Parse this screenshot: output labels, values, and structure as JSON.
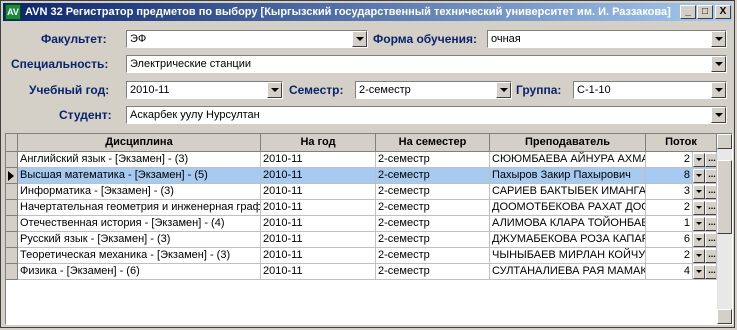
{
  "window": {
    "title": "AVN 32 Регистратор предметов по выбору [Кыргызский государственный технический университет им. И. Раззакова]",
    "icon_label": "AV",
    "buttons": [
      "_",
      "□",
      "X"
    ]
  },
  "form": {
    "faculty_label": "Факультет:",
    "faculty_value": "ЭФ",
    "study_form_label": "Форма обучения:",
    "study_form_value": "очная",
    "specialty_label": "Специальность:",
    "specialty_value": "Электрические станции",
    "year_label": "Учебный год:",
    "year_value": "2010-11",
    "semester_label": "Семестр:",
    "semester_value": "2-семестр",
    "group_label": "Группа:",
    "group_value": "С-1-10",
    "student_label": "Студент:",
    "student_value": "Аскарбек уулу Нурсултан"
  },
  "table": {
    "headers": [
      "Дисциплина",
      "На год",
      "На семестер",
      "Преподаватель",
      "Поток"
    ],
    "rows": [
      {
        "discipline": "Английский язык - [Экзамен] - (3)",
        "year": "2010-11",
        "semester": "2-семестр",
        "teacher": "СЮЮМБАЕВА АЙНУРА АХМАТБЕ",
        "potok": "2"
      },
      {
        "discipline": "Высшая математика - [Экзамен] - (5)",
        "year": "2010-11",
        "semester": "2-семестр",
        "teacher": "Пахыров Закир Пахырович",
        "potok": "8"
      },
      {
        "discipline": "Информатика - [Экзамен] - (3)",
        "year": "2010-11",
        "semester": "2-семестр",
        "teacher": "САРИЕВ БАКТЫБЕК ИМАНГАЗИ",
        "potok": "3"
      },
      {
        "discipline": "Начертательная геометрия и инженерная графика",
        "year": "2010-11",
        "semester": "2-семестр",
        "teacher": "ДООМОТБЕКОВА РАХАТ ДООМ",
        "potok": "2"
      },
      {
        "discipline": "Отечественная история - [Экзамен] - (4)",
        "year": "2010-11",
        "semester": "2-семестр",
        "teacher": "АЛИМОВА КЛАРА ТОЙОНБАЕВА",
        "potok": "1"
      },
      {
        "discipline": "Русский язык - [Экзамен] - (3)",
        "year": "2010-11",
        "semester": "2-семестр",
        "teacher": "ДЖУМАБЕКОВА РОЗА КАПАРО",
        "potok": "6"
      },
      {
        "discipline": "Теоретическая  механика - [Экзамен] - (3)",
        "year": "2010-11",
        "semester": "2-семестр",
        "teacher": "ЧЫНЫБАЕВ МИРЛАН КОЙЧУБЕ",
        "potok": "2"
      },
      {
        "discipline": "Физика - [Экзамен] - (6)",
        "year": "2010-11",
        "semester": "2-семестр",
        "teacher": "СУЛТАНАЛИЕВА РАЯ МАМАКЕЕ",
        "potok": "4"
      }
    ],
    "selected_row": 1,
    "ellipsis": "..."
  },
  "colors": {
    "title_start": "#0a246a",
    "title_end": "#a6caf0",
    "label": "#0a246a",
    "selection": "#a6caf0"
  }
}
